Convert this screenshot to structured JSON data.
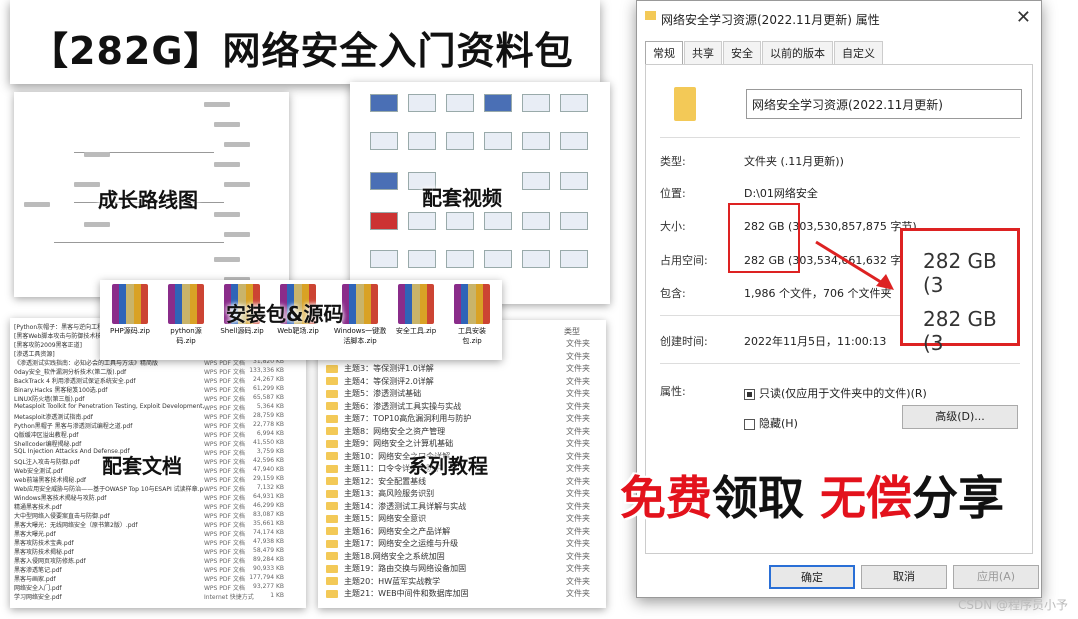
{
  "banner": {
    "title": "【282G】网络安全入门资料包"
  },
  "labels": {
    "roadmap": "成长路线图",
    "videos": "配套视频",
    "packages": "安装包&源码",
    "docs": "配套文档",
    "course": "系列教程"
  },
  "zips": [
    {
      "name": "PHP源码.zip"
    },
    {
      "name": "python源码.zip"
    },
    {
      "name": "Shell源码.zip"
    },
    {
      "name": "Web靶场.zip"
    },
    {
      "name": "Windows一键激活脚本.zip"
    },
    {
      "name": "安全工具.zip"
    },
    {
      "name": "工具安装包.zip"
    }
  ],
  "docs": [
    {
      "name": "[Python灰帽子：黑客与逆向工程师]",
      "type": "WPS PDF 文档",
      "size": "9,341 KB"
    },
    {
      "name": "[黑客Web脚本攻击与防御技术核心]",
      "type": "WPS PDF 文档",
      "size": "28,517 KB"
    },
    {
      "name": "[黑客攻防2009黑客正道]",
      "type": "WPS PDF 文档",
      "size": "52,630 KB"
    },
    {
      "name": "[渗透工具资源]",
      "type": "WPS PDF 文档",
      "size": "11,886 KB"
    },
    {
      "name": "《渗透测试实践指南：必知必会的工具与方法》精简版",
      "type": "WPS PDF 文档",
      "size": "31,820 KB"
    },
    {
      "name": "0day安全_软件漏洞分析技术(第二版).pdf",
      "type": "WPS PDF 文档",
      "size": "133,336 KB"
    },
    {
      "name": "BackTrack 4 利用渗透测试保证系统安全.pdf",
      "type": "WPS PDF 文档",
      "size": "24,267 KB"
    },
    {
      "name": "Binary.Hacks 黑客秘笈100选.pdf",
      "type": "WPS PDF 文档",
      "size": "61,299 KB"
    },
    {
      "name": "LINUX防火墙(第三版).pdf",
      "type": "WPS PDF 文档",
      "size": "65,587 KB"
    },
    {
      "name": "Metasploit Toolkit for Penetration Testing, Exploit Development, & Vulnerab...",
      "type": "WPS PDF 文档",
      "size": "5,364 KB"
    },
    {
      "name": "Metasploit渗透测试指南.pdf",
      "type": "WPS PDF 文档",
      "size": "28,759 KB"
    },
    {
      "name": "Python黑帽子 黑客与渗透测试编程之道.pdf",
      "type": "WPS PDF 文档",
      "size": "22,778 KB"
    },
    {
      "name": "Q版缓冲区溢出教程.pdf",
      "type": "WPS PDF 文档",
      "size": "6,994 KB"
    },
    {
      "name": "Shellcoder编程揭秘.pdf",
      "type": "WPS PDF 文档",
      "size": "41,550 KB"
    },
    {
      "name": "SQL Injection Attacks And Defense.pdf",
      "type": "WPS PDF 文档",
      "size": "3,759 KB"
    },
    {
      "name": "SQL注入攻击与防御.pdf",
      "type": "WPS PDF 文档",
      "size": "42,596 KB"
    },
    {
      "name": "Web安全测试.pdf",
      "type": "WPS PDF 文档",
      "size": "47,940 KB"
    },
    {
      "name": "web前端黑客技术揭秘.pdf",
      "type": "WPS PDF 文档",
      "size": "29,159 KB"
    },
    {
      "name": "Web应用安全威胁与防治——基于OWASP Top 10与ESAPI 试读样章.pdf",
      "type": "WPS PDF 文档",
      "size": "7,132 KB"
    },
    {
      "name": "Windows黑客技术揭秘与攻防.pdf",
      "type": "WPS PDF 文档",
      "size": "64,931 KB"
    },
    {
      "name": "精通黑客技术.pdf",
      "type": "WPS PDF 文档",
      "size": "46,299 KB"
    },
    {
      "name": "大中型网络入侵要案直击与防御.pdf",
      "type": "WPS PDF 文档",
      "size": "83,087 KB"
    },
    {
      "name": "黑客大曝光：无线网络安全（原书第2版）.pdf",
      "type": "WPS PDF 文档",
      "size": "35,661 KB"
    },
    {
      "name": "黑客大曝光.pdf",
      "type": "WPS PDF 文档",
      "size": "74,174 KB"
    },
    {
      "name": "黑客攻防技术宝典.pdf",
      "type": "WPS PDF 文档",
      "size": "47,938 KB"
    },
    {
      "name": "黑客攻防技术揭秘.pdf",
      "type": "WPS PDF 文档",
      "size": "58,479 KB"
    },
    {
      "name": "黑客入侵网页攻防修炼.pdf",
      "type": "WPS PDF 文档",
      "size": "89,284 KB"
    },
    {
      "name": "黑客渗透笔记.pdf",
      "type": "WPS PDF 文档",
      "size": "90,933 KB"
    },
    {
      "name": "黑客与画家.pdf",
      "type": "WPS PDF 文档",
      "size": "177,794 KB"
    },
    {
      "name": "网络安全入门.pdf",
      "type": "WPS PDF 文档",
      "size": "93,277 KB"
    },
    {
      "name": "学习网络安全.pdf",
      "type": "Internet 快捷方式",
      "size": "1 KB"
    }
  ],
  "course": {
    "header_type": "类型",
    "items": [
      {
        "name": "主题1：开学第一课",
        "type": "文件夹"
      },
      {
        "name": "主题2：网络攻击前沿——ATT&CK框架",
        "type": "文件夹"
      },
      {
        "name": "主题3：等保测评1.0详解",
        "type": "文件夹"
      },
      {
        "name": "主题4：等保测评2.0详解",
        "type": "文件夹"
      },
      {
        "name": "主题5：渗透测试基础",
        "type": "文件夹"
      },
      {
        "name": "主题6：渗透测试工具实操与实战",
        "type": "文件夹"
      },
      {
        "name": "主题7：TOP10高危漏洞利用与防护",
        "type": "文件夹"
      },
      {
        "name": "主题8：网络安全之资产管理",
        "type": "文件夹"
      },
      {
        "name": "主题9：网络安全之计算机基础",
        "type": "文件夹"
      },
      {
        "name": "主题10：网络安全之口令详解",
        "type": "文件夹"
      },
      {
        "name": "主题11：口令令详解与防护",
        "type": "文件夹"
      },
      {
        "name": "主题12：安全配置基线",
        "type": "文件夹"
      },
      {
        "name": "主题13：高风险服务识别",
        "type": "文件夹"
      },
      {
        "name": "主题14：渗透测试工具详解与实战",
        "type": "文件夹"
      },
      {
        "name": "主题15：网络安全意识",
        "type": "文件夹"
      },
      {
        "name": "主题16：网络安全之产品详解",
        "type": "文件夹"
      },
      {
        "name": "主题17：网络安全之运维与升级",
        "type": "文件夹"
      },
      {
        "name": "主题18.网络安全之系统加固",
        "type": "文件夹"
      },
      {
        "name": "主题19：路由交换与网络设备加固",
        "type": "文件夹"
      },
      {
        "name": "主题20：HW蓝军实战教学",
        "type": "文件夹"
      },
      {
        "name": "主题21：WEB中间件和数据库加固",
        "type": "文件夹"
      }
    ]
  },
  "dialog": {
    "title": "网络安全学习资源(2022.11月更新) 属性",
    "close": "✕",
    "tabs": [
      "常规",
      "共享",
      "安全",
      "以前的版本",
      "自定义"
    ],
    "name": "网络安全学习资源(2022.11月更新)",
    "fields": {
      "type_label": "类型:",
      "type_value": "文件夹 (.11月更新))",
      "location_label": "位置:",
      "location_value": "D:\\01网络安全",
      "size_label": "大小:",
      "size_value": "282 GB (303,530,857,875 字节)",
      "disk_label": "占用空间:",
      "disk_value": "282 GB (303,534,661,632 字",
      "contains_label": "包含:",
      "contains_value": "1,986 个文件，706 个文件夹",
      "created_label": "创建时间:",
      "created_value": "2022年11月5日，11:00:13",
      "attr_label": "属性:",
      "readonly": "只读(仅应用于文件夹中的文件)(R)",
      "hidden": "隐藏(H)",
      "advanced": "高级(D)..."
    },
    "zoom": {
      "line1": "282 GB (3",
      "line2": "282 GB (3"
    },
    "buttons": {
      "ok": "确定",
      "cancel": "取消",
      "apply": "应用(A)"
    }
  },
  "promo": {
    "part1": "免费",
    "part2": "领取 ",
    "part3": "无偿",
    "part4": "分享"
  },
  "watermark": "CSDN @程序员小予"
}
